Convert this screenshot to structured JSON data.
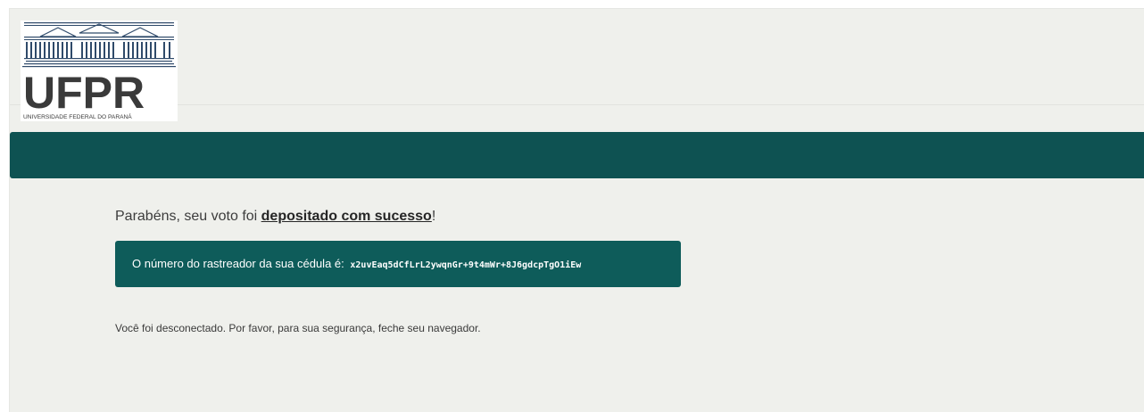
{
  "header": {
    "logo": {
      "name": "UFPR",
      "subtitle": "UNIVERSIDADE FEDERAL DO PARANÁ"
    }
  },
  "colors": {
    "brand_green": "#0e5252",
    "tracker_box_green": "#0e5c5a",
    "page_background": "#eff0ec"
  },
  "main": {
    "success_prefix": "Parabéns, seu voto foi ",
    "success_emphasis": "depositado com sucesso",
    "success_suffix": "!",
    "tracker_label": "O número do rastreador da sua cédula é:",
    "tracker_code": "x2uvEaq5dCfLrL2ywqnGr+9t4mWr+8J6gdcpTgO1iEw",
    "logout_message": "Você foi desconectado. Por favor, para sua segurança, feche seu navegador."
  }
}
